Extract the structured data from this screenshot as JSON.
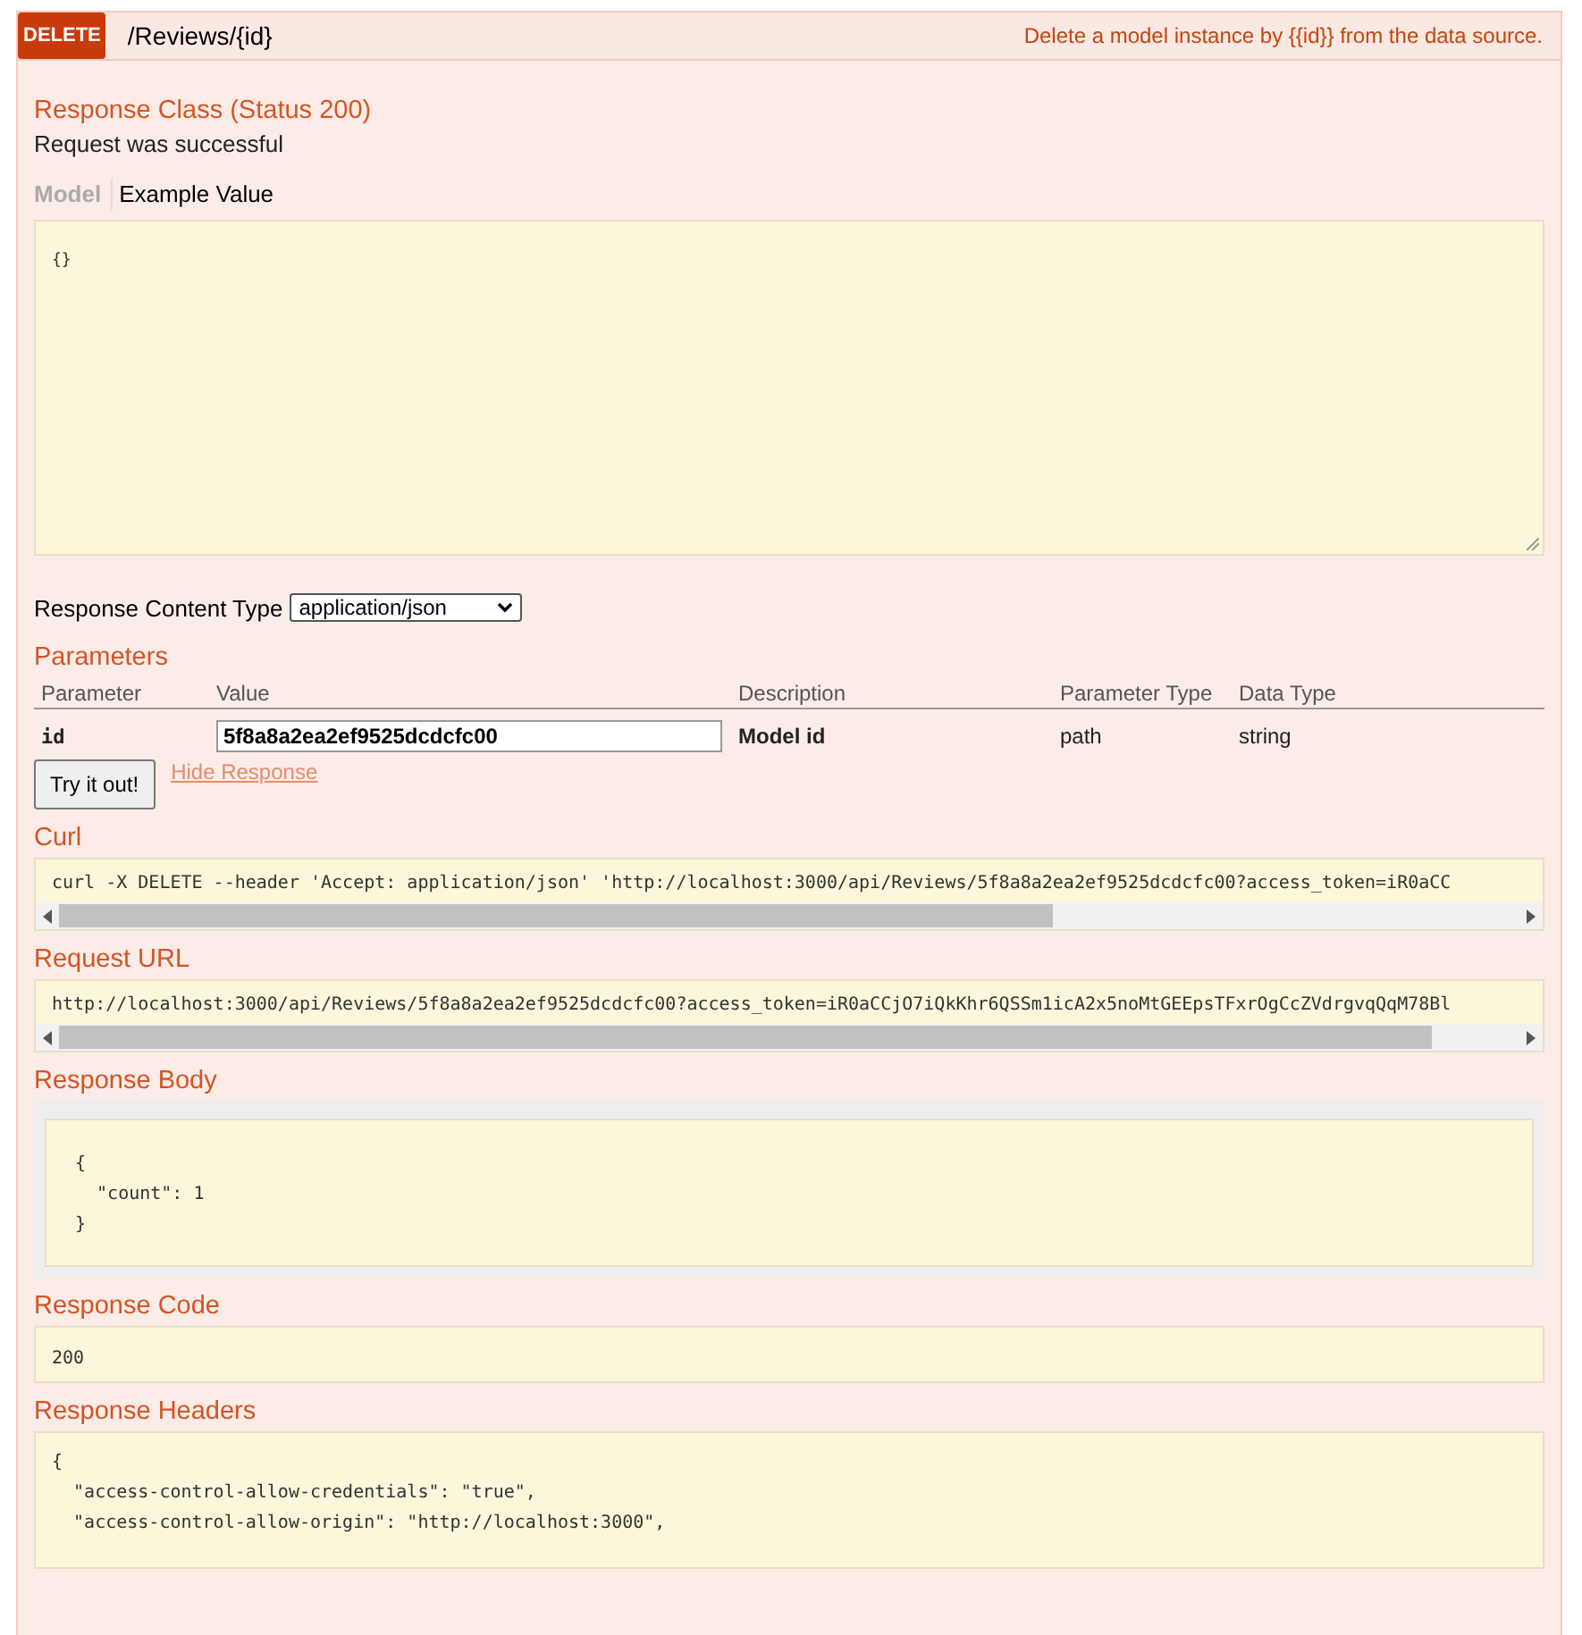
{
  "operation": {
    "method": "DELETE",
    "path": "/Reviews/{id}",
    "summary": "Delete a model instance by {{id}} from the data source."
  },
  "response_class": {
    "title": "Response Class (Status 200)",
    "description": "Request was successful",
    "tabs": [
      {
        "label": "Model",
        "selected": false
      },
      {
        "label": "Example Value",
        "selected": true
      }
    ],
    "example": "{}"
  },
  "content_type": {
    "label": "Response Content Type",
    "value": "application/json"
  },
  "parameters": {
    "title": "Parameters",
    "columns": [
      "Parameter",
      "Value",
      "Description",
      "Parameter Type",
      "Data Type"
    ],
    "rows": [
      {
        "name": "id",
        "value": "5f8a8a2ea2ef9525dcdcfc00",
        "description": "Model id",
        "param_type": "path",
        "data_type": "string"
      }
    ]
  },
  "try_button": "Try it out!",
  "hide_link": "Hide Response",
  "curl": {
    "title": "Curl",
    "text": "curl -X DELETE --header 'Accept: application/json' 'http://localhost:3000/api/Reviews/5f8a8a2ea2ef9525dcdcfc00?access_token=iR0aCC"
  },
  "request_url": {
    "title": "Request URL",
    "text": "http://localhost:3000/api/Reviews/5f8a8a2ea2ef9525dcdcfc00?access_token=iR0aCCjO7iQkKhr6QSSm1icA2x5noMtGEEpsTFxrOgCcZVdrgvqQqM78Bl"
  },
  "response_body": {
    "title": "Response Body",
    "lines": [
      "{",
      "  \"count\": 1",
      "}"
    ]
  },
  "response_code": {
    "title": "Response Code",
    "value": "200"
  },
  "response_headers": {
    "title": "Response Headers",
    "lines": [
      "{",
      "  \"access-control-allow-credentials\": \"true\",",
      "  \"access-control-allow-origin\": \"http://localhost:3000\","
    ]
  }
}
